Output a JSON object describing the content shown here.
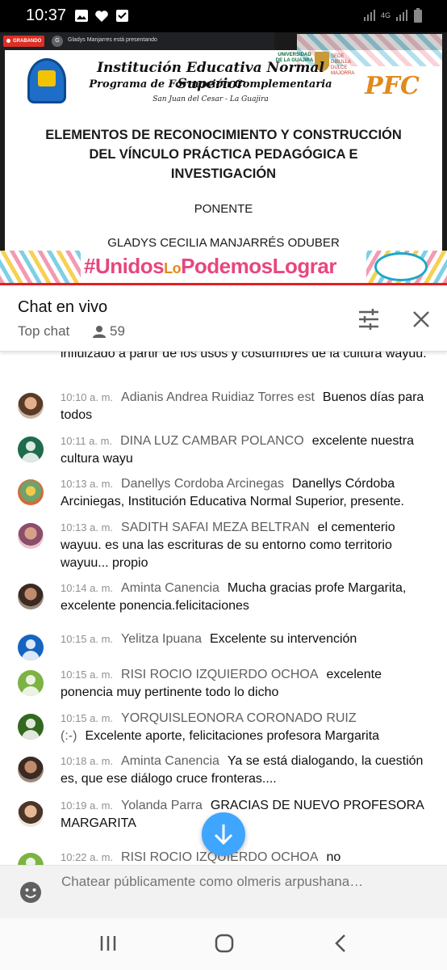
{
  "status_bar": {
    "time": "10:37",
    "network": "4G"
  },
  "video": {
    "recording_label": "GRABANDO",
    "presenter_initial": "G",
    "presenter_text": "Gladys Manjarres está presentando",
    "university_logo_text": "UNIVERSIDAD DE LA GUAJIRA",
    "sede_text": "SEDE DIBULLA DULCE MAJORRA",
    "pfc_logo": "PFC",
    "institution_title": "Institución Educativa Normal Superior",
    "program_title": "Programa de Formación Complementaria",
    "city": "San Juan del Cesar - La Guajira",
    "slide_title": "ELEMENTOS DE RECONOCIMIENTO Y CONSTRUCCIÓN DEL VÍNCULO PRÁCTICA PEDAGÓGICA E INVESTIGACIÓN",
    "ponente_label": "PONENTE",
    "ponente_name": "GLADYS CECILIA MANJARRÉS ODUBER",
    "banner_hashtag_a": "#Unidos",
    "banner_hashtag_b": "Lo",
    "banner_hashtag_c": "Podemos",
    "banner_hashtag_d": "Lograr"
  },
  "chat_header": {
    "title": "Chat en vivo",
    "mode": "Top chat",
    "viewer_count": "59"
  },
  "messages": {
    "partial_text": "influizado a partir de los usos y costumbres de la cultura wayuu.",
    "items": [
      {
        "time": "10:10 a. m.",
        "author": "Adianis Andrea Ruidiaz Torres est",
        "text": "Buenos días para todos",
        "avatar": "photo"
      },
      {
        "time": "10:11 a. m.",
        "author": "DINA LUZ CAMBAR POLANCO",
        "text": "excelente nuestra cultura wayu",
        "avatar": "generic",
        "color": "#1e6b4e"
      },
      {
        "time": "10:13 a. m.",
        "author": "Danellys Cordoba Arcinegas",
        "text": "Danellys Córdoba Arciniegas, Institución Educativa Normal Superior, presente.",
        "avatar": "photo3"
      },
      {
        "time": "10:13 a. m.",
        "author": "SADITH SAFAI MEZA BELTRAN",
        "text": "el cementerio wayuu. es una las escrituras de su entorno como territorio wayuu... propio",
        "avatar": "photo4"
      },
      {
        "time": "10:14 a. m.",
        "author": "Aminta Canencia",
        "text": "Mucha gracias profe Margarita, excelente ponencia.felicitaciones",
        "avatar": "photo5"
      },
      {
        "time": "10:15 a. m.",
        "author": "Yelitza Ipuana",
        "text": "Excelente su intervención",
        "avatar": "generic",
        "color": "#1565c0"
      },
      {
        "time": "10:15 a. m.",
        "author": "RISI ROCIO IZQUIERDO OCHOA",
        "text": "excelente ponencia muy pertinente todo lo dicho",
        "avatar": "generic",
        "color": "#7cb342"
      },
      {
        "time": "10:15 a. m.",
        "author": "YORQUISLEONORA CORONADO RUIZ (:-)",
        "text": "Excelente aporte, felicitaciones profesora Margarita",
        "avatar": "generic",
        "color": "#33691e"
      },
      {
        "time": "10:18 a. m.",
        "author": "Aminta Canencia",
        "text": "Ya se está dialogando, la cuestión es, que ese diálogo cruce fronteras....",
        "avatar": "photo5"
      },
      {
        "time": "10:19 a. m.",
        "author": "Yolanda Parra",
        "text": "GRACIAS DE NUEVO PROFESORA MARGARITA",
        "avatar": "photo6"
      },
      {
        "time": "10:22 a. m.",
        "author": "RISI ROCIO IZQUIERDO OCHOA",
        "text": "no",
        "avatar": "generic",
        "color": "#7cb342"
      }
    ]
  },
  "input": {
    "placeholder": "Chatear públicamente como olmeris arpushana…"
  },
  "colors": {
    "accent_blue": "#3ea6ff",
    "recording_red": "#d93025"
  }
}
